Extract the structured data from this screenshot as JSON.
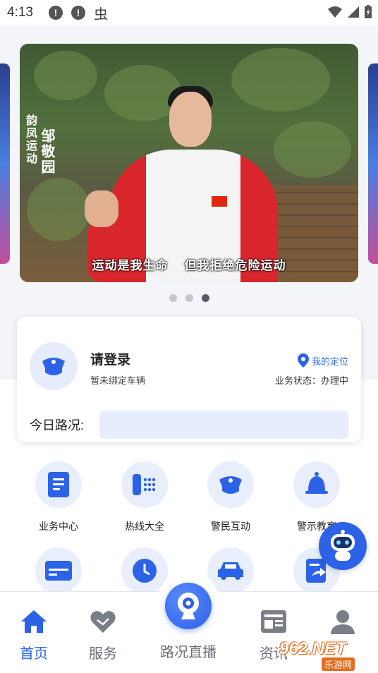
{
  "status_bar": {
    "time": "4:13",
    "alert_icon_1": "!",
    "alert_icon_2": "!",
    "bug_icon": "虫"
  },
  "carousel": {
    "name_vertical": "邹敬园",
    "name_vertical_side": "韵凤运动",
    "subtitle": "运动是我生命    但我拒绝危险运动",
    "dots": 3,
    "active_dot": 3
  },
  "user_card": {
    "login_title": "请登录",
    "unbound_text": "暂未绑定车辆",
    "location_label": "我的定位",
    "business_status": "业务状态：办理中",
    "traffic_label": "今日路况:"
  },
  "grid": [
    {
      "label": "业务中心",
      "icon": "document-icon"
    },
    {
      "label": "热线大全",
      "icon": "phone-icon"
    },
    {
      "label": "警民互动",
      "icon": "police-cap-icon"
    },
    {
      "label": "警示教育",
      "icon": "bell-icon"
    },
    {
      "label": "",
      "icon": "id-card-icon"
    },
    {
      "label": "",
      "icon": "clock-icon"
    },
    {
      "label": "",
      "icon": "car-icon"
    },
    {
      "label": "",
      "icon": "share-doc-icon"
    }
  ],
  "bottom_nav": {
    "home": "首页",
    "service": "服务",
    "live": "路况直播",
    "news": "资讯",
    "mine": ""
  },
  "watermark": {
    "main": "962.NET",
    "sub": "乐游网"
  },
  "colors": {
    "accent": "#2c63e6",
    "icon_bg": "#e8eefb",
    "traffic_box": "#e7edfb"
  }
}
